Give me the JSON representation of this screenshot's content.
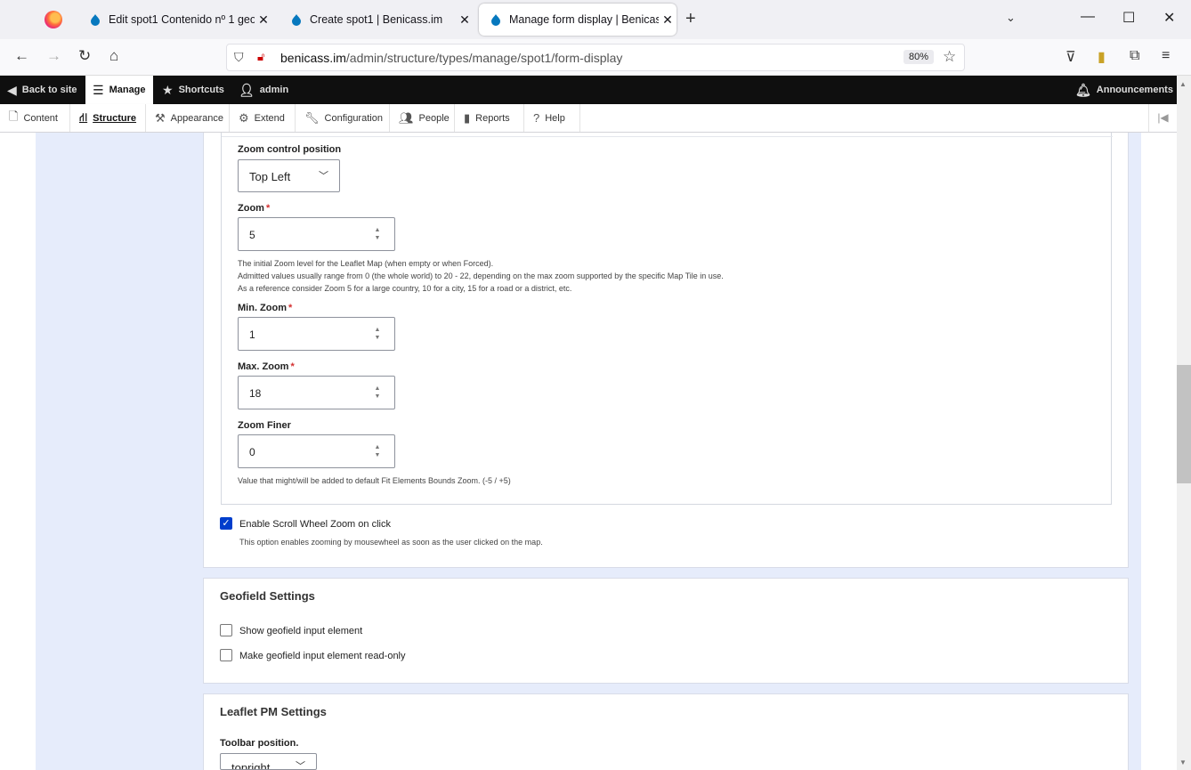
{
  "browser": {
    "tabs": [
      {
        "label": "Edit spot1 Contenido nº 1 geolo",
        "active": false
      },
      {
        "label": "Create spot1 | Benicass.im",
        "active": false
      },
      {
        "label": "Manage form display | Benicass",
        "active": true
      }
    ],
    "url_host": "benicass.im",
    "url_path": "/admin/structure/types/manage/spot1/form-display",
    "zoom": "80%"
  },
  "toolbar": {
    "back_to_site": "Back to site",
    "manage": "Manage",
    "shortcuts": "Shortcuts",
    "user": "admin",
    "announcements": "Announcements"
  },
  "tray": {
    "content": "Content",
    "structure": "Structure",
    "appearance": "Appearance",
    "extend": "Extend",
    "configuration": "Configuration",
    "people": "People",
    "reports": "Reports",
    "help": "Help"
  },
  "form": {
    "zoom_control_position": {
      "label": "Zoom control position",
      "value": "Top Left"
    },
    "zoom": {
      "label": "Zoom",
      "value": "5",
      "desc1": "The initial Zoom level for the Leaflet Map (when empty or when Forced).",
      "desc2": "Admitted values usually range from 0 (the whole world) to 20 - 22, depending on the max zoom supported by the specific Map Tile in use.",
      "desc3": "As a reference consider Zoom 5 for a large country, 10 for a city, 15 for a road or a district, etc."
    },
    "min_zoom": {
      "label": "Min. Zoom",
      "value": "1"
    },
    "max_zoom": {
      "label": "Max. Zoom",
      "value": "18"
    },
    "zoom_finer": {
      "label": "Zoom Finer",
      "value": "0",
      "desc": "Value that might/will be added to default Fit Elements Bounds Zoom. (-5 / +5)"
    },
    "required_marker": "*",
    "scroll_wheel": {
      "label": "Enable Scroll Wheel Zoom on click",
      "desc": "This option enables zooming by mousewheel as soon as the user clicked on the map.",
      "checked": true
    }
  },
  "geofield": {
    "title": "Geofield Settings",
    "show_input": "Show geofield input element",
    "readonly_input": "Make geofield input element read-only"
  },
  "leaflet_pm": {
    "title": "Leaflet PM Settings",
    "toolbar_position_label": "Toolbar position.",
    "toolbar_position_value": "topright"
  },
  "colors": {
    "accent": "#003ecc",
    "toolbar": "#0f0f0f",
    "page_bg": "#e6ecfb"
  }
}
